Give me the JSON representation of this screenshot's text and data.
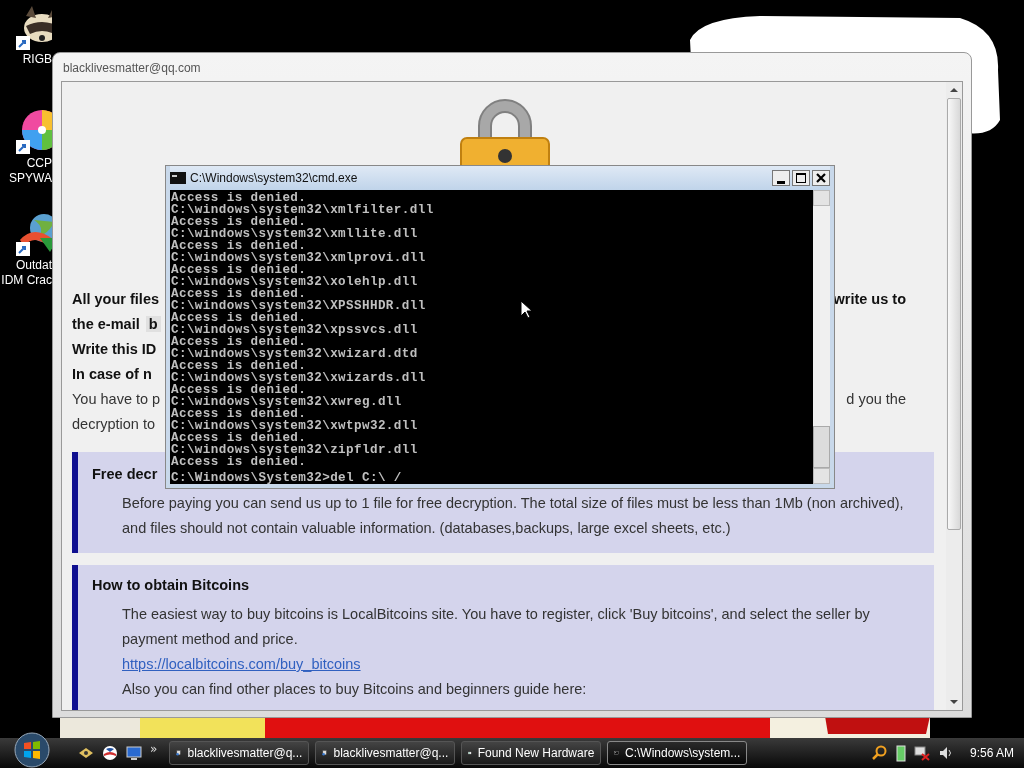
{
  "desktop_icons": [
    {
      "kind": "animal",
      "lines": [
        "RIGB"
      ]
    },
    {
      "kind": "pinwheel",
      "lines": [
        "CCP",
        "SPYWA"
      ]
    },
    {
      "kind": "globe",
      "lines": [
        "Outdat",
        "IDM Crac"
      ]
    }
  ],
  "note_window": {
    "title": "blacklivesmatter@qq.com",
    "lines": [
      {
        "bold": true,
        "left": "All your files",
        "right": "write us to"
      },
      {
        "bold": true,
        "left": "the e-mail",
        "code": "b"
      },
      {
        "bold": true,
        "left": "Write this ID"
      },
      {
        "bold": true,
        "left": "In case of n"
      },
      {
        "bold": false,
        "left": "You have to p",
        "right": "d you the"
      },
      {
        "bold": false,
        "left": "decryption to"
      }
    ],
    "sections": [
      {
        "heading": "Free decr",
        "paragraphs": [
          {
            "kind": "text",
            "text": "Before paying you can send us up to 1 file for free decryption. The total size of files must be less than 1Mb (non archived), and files should not contain valuable information. (databases,backups, large excel sheets, etc.)"
          }
        ]
      },
      {
        "heading": "How to obtain Bitcoins",
        "paragraphs": [
          {
            "kind": "text",
            "text": "The easiest way to buy bitcoins is LocalBitcoins site. You have to register, click 'Buy bitcoins', and select the seller by payment method and price."
          },
          {
            "kind": "link",
            "text": "https://localbitcoins.com/buy_bitcoins"
          },
          {
            "kind": "text",
            "text": "Also you can find other places to buy Bitcoins and beginners guide here:"
          }
        ]
      }
    ]
  },
  "cmd_window": {
    "title": "C:\\Windows\\system32\\cmd.exe",
    "lines": [
      "Access is denied.",
      "C:\\windows\\system32\\xmlfilter.dll",
      "Access is denied.",
      "C:\\windows\\system32\\xmllite.dll",
      "Access is denied.",
      "C:\\windows\\system32\\xmlprovi.dll",
      "Access is denied.",
      "C:\\windows\\system32\\xolehlp.dll",
      "Access is denied.",
      "C:\\windows\\system32\\XPSSHHDR.dll",
      "Access is denied.",
      "C:\\windows\\system32\\xpssvcs.dll",
      "Access is denied.",
      "C:\\windows\\system32\\xwizard.dtd",
      "Access is denied.",
      "C:\\windows\\system32\\xwizards.dll",
      "Access is denied.",
      "C:\\windows\\system32\\xwreg.dll",
      "Access is denied.",
      "C:\\windows\\system32\\xwtpw32.dll",
      "Access is denied.",
      "C:\\windows\\system32\\zipfldr.dll",
      "Access is denied."
    ],
    "prompt": "C:\\Windows\\System32>del C:\\ /"
  },
  "taskbar": {
    "chevron": "»",
    "tasks": [
      {
        "kind": "app",
        "label": "blacklivesmatter@q...",
        "selected": false
      },
      {
        "kind": "app",
        "label": "blacklivesmatter@q...",
        "selected": false
      },
      {
        "kind": "hardware",
        "label": "Found New Hardware",
        "selected": false
      },
      {
        "kind": "console",
        "label": "C:\\Windows\\system...",
        "selected": true
      }
    ],
    "clock": "9:56 AM"
  }
}
